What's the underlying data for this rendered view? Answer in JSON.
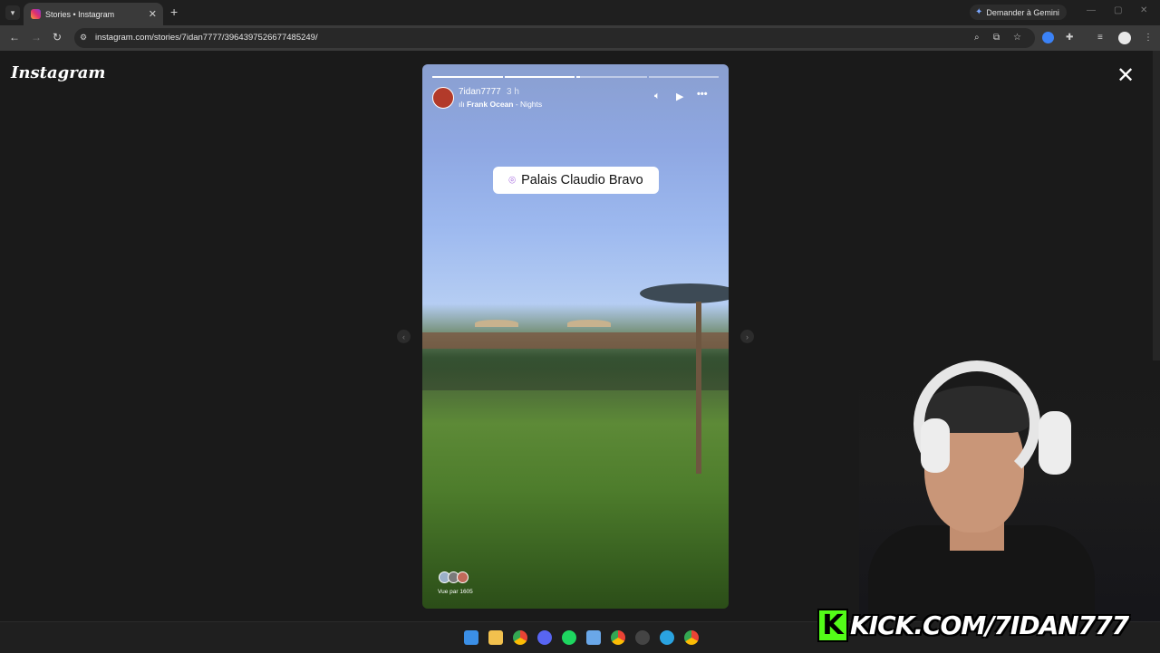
{
  "browser": {
    "tab_title": "Stories • Instagram",
    "tab_close": "✕",
    "new_tab": "+",
    "gemini_label": "Demander à Gemini",
    "url": "instagram.com/stories/7idan7777/3964397526677485249/"
  },
  "page": {
    "logo": "Instagram",
    "close_label": "✕"
  },
  "story": {
    "progress_segments": 4,
    "current_segment": 3,
    "current_progress": 0.05,
    "username": "7idan7777",
    "time": "3 h",
    "music_artist": "Frank Ocean",
    "music_separator": " - ",
    "music_title": "Nights",
    "location": "Palais Claudio Bravo",
    "viewers_text": "Vue par 1605"
  },
  "overlay": {
    "stream_url": "KICK.COM/7IDAN777",
    "kick_letter": "K"
  },
  "icons": {
    "tab_list": "chevron-down-icon",
    "back": "arrow-left-icon",
    "forward": "arrow-right-icon",
    "reload": "reload-icon",
    "zoom": "zoom-icon",
    "bookmark": "star-icon",
    "mute": "speaker-icon",
    "play": "play-icon",
    "more": "more-icon",
    "pin": "location-pin-icon"
  },
  "colors": {
    "accent_location": "#8a3ad6",
    "kick_green": "#53fc18",
    "avatar_red": "#b23a2a"
  }
}
